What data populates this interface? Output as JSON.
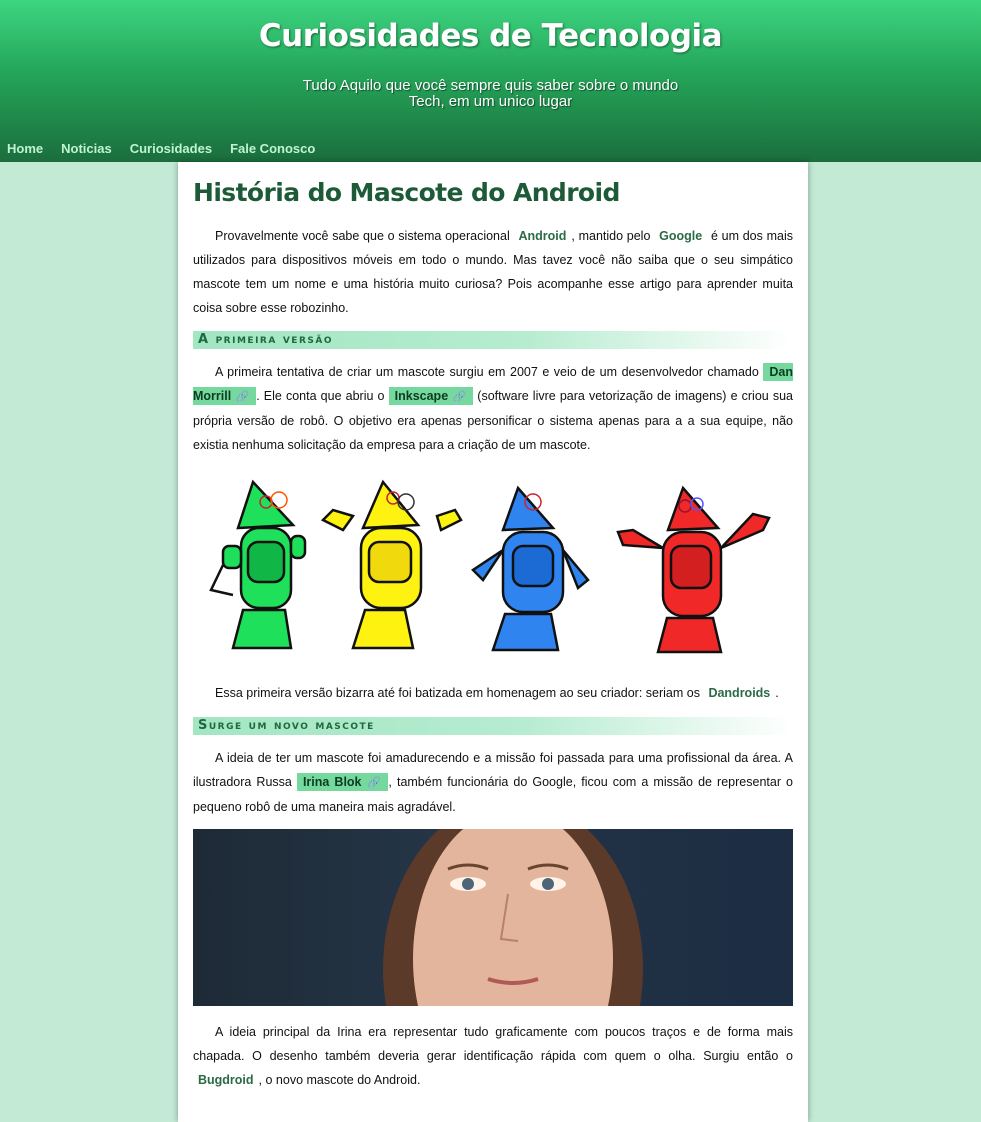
{
  "site": {
    "title": "Curiosidades de Tecnologia",
    "subtitle_line1": "Tudo Aquilo que você sempre quis saber sobre o mundo",
    "subtitle_line2": "Tech, em um unico lugar"
  },
  "nav": {
    "home": "Home",
    "noticias": "Noticias",
    "curiosidades": "Curiosidades",
    "fale": "Fale Conosco"
  },
  "article": {
    "title": "História do Mascote do Android",
    "p1": {
      "a": "Provavelmente você sabe que o sistema operacional",
      "kw1": "Android",
      "b": ", mantido pelo",
      "kw2": "Google",
      "c": "é um dos mais utilizados para dispositivos móveis em todo o mundo. Mas tavez você não saiba que o seu simpático mascote tem um nome e uma história muito curiosa? Pois acompanhe esse artigo para aprender muita coisa sobre esse robozinho."
    },
    "h1": "A primeira versão",
    "p2": {
      "a": "A primeira tentativa de criar um mascote surgiu em 2007 e veio de um desenvolvedor chamado",
      "link1": "Dan Morrill",
      "b": ". Ele conta que abriu o",
      "link2": "Inkscape",
      "c": "(software livre para vetorização de imagens) e criou sua própria versão de robô. O objetivo era apenas personificar o sistema apenas para a a sua equipe, não existia nenhuma solicitação da empresa para a criação de um mascote."
    },
    "p3": {
      "a": "Essa primeira versão bizarra até foi batizada em homenagem ao seu criador: seriam os",
      "kw": "Dandroids",
      "b": "."
    },
    "h2": "Surge um novo mascote",
    "p4": {
      "a": "A ideia de ter um mascote foi amadurecendo e a missão foi passada para uma profissional da área. A ilustradora Russa",
      "link": "Irina Blok",
      "b": ", também funcionária do Google, ficou com a missão de representar o pequeno robô de uma maneira mais agradável."
    },
    "p5": {
      "a": "A ideia principal da Irina era representar tudo graficamente com poucos traços e de forma mais chapada. O desenho também deveria gerar identificação rápida com quem o olha. Surgiu então o",
      "kw": "Bugdroid",
      "b": ", o novo mascote do Android."
    },
    "clip_icon": "🔗"
  },
  "colors": {
    "header_top": "#3dd581",
    "header_bottom": "#1b6e3c",
    "page_bg": "#c2ead5",
    "link_bg": "#74d89f",
    "title": "#1d5a37"
  },
  "icons": [
    "paperclip-icon"
  ]
}
